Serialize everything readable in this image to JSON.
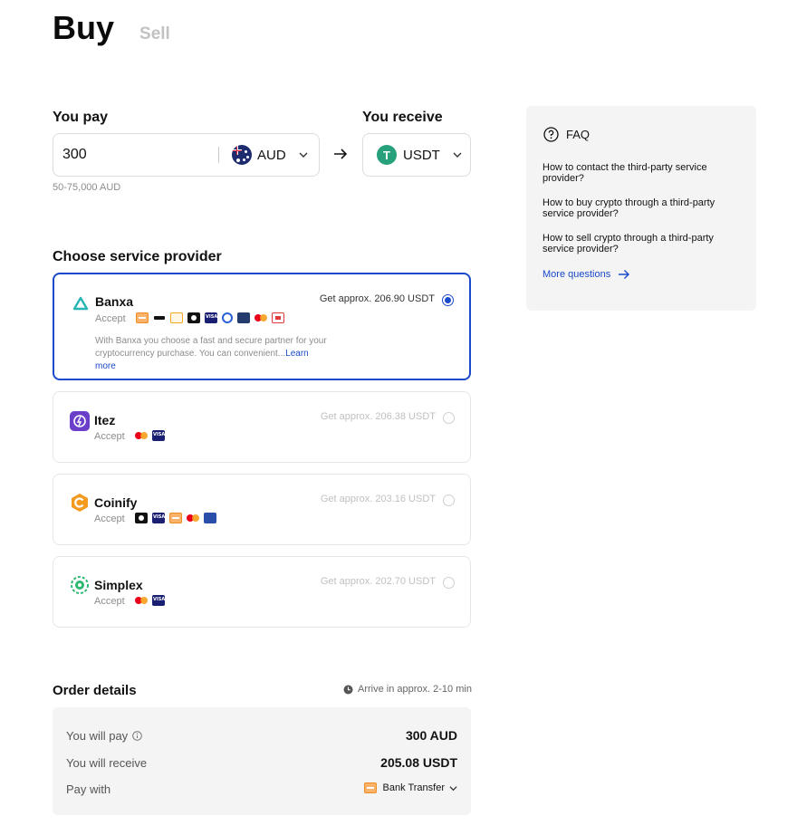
{
  "tabs": {
    "buy": "Buy",
    "sell": "Sell"
  },
  "pay": {
    "label": "You pay",
    "amount": "300",
    "currency": "AUD",
    "range": "50-75,000 AUD"
  },
  "receive": {
    "label": "You receive",
    "currency": "USDT",
    "currency_symbol": "T"
  },
  "providers_section": {
    "title": "Choose service provider"
  },
  "providers": [
    {
      "name": "Banxa",
      "accept_label": "Accept",
      "approx": "Get approx. 206.90 USDT",
      "selected": true,
      "methods": [
        "bank-transfer-icon",
        "card-icon",
        "wallet-icon",
        "apple-pay-icon",
        "visa-icon",
        "google-pay-icon",
        "pay-id-icon",
        "mastercard-icon",
        "poli-icon"
      ],
      "description": "With Banxa you choose a fast and secure partner for your cryptocurrency purchase. You can convenient",
      "ellipsis": "...",
      "learn_more": "Learn more"
    },
    {
      "name": "Itez",
      "accept_label": "Accept",
      "approx": "Get approx. 206.38 USDT",
      "selected": false,
      "methods": [
        "mastercard-icon",
        "visa-icon"
      ]
    },
    {
      "name": "Coinify",
      "accept_label": "Accept",
      "approx": "Get approx. 203.16 USDT",
      "selected": false,
      "methods": [
        "apple-pay-icon",
        "visa-icon",
        "bank-transfer-icon",
        "mastercard-icon",
        "sepa-icon"
      ]
    },
    {
      "name": "Simplex",
      "accept_label": "Accept",
      "approx": "Get approx. 202.70 USDT",
      "selected": false,
      "methods": [
        "mastercard-icon",
        "visa-icon"
      ]
    }
  ],
  "faq": {
    "title": "FAQ",
    "questions": [
      "How to contact the third-party service provider?",
      "How to buy crypto through a third-party service provider?",
      "How to sell crypto through a third-party service provider?"
    ],
    "more": "More questions"
  },
  "order": {
    "title": "Order details",
    "arrive": "Arrive in approx. 2-10 min",
    "pay_label": "You will pay",
    "pay_value": "300 AUD",
    "receive_label": "You will receive",
    "receive_value": "205.08 USDT",
    "paywith_label": "Pay with",
    "paywith_value": "Bank Transfer"
  },
  "colors": {
    "accent": "#1a49c9",
    "tether": "#26a17b",
    "panel_bg": "#f4f4f4"
  }
}
